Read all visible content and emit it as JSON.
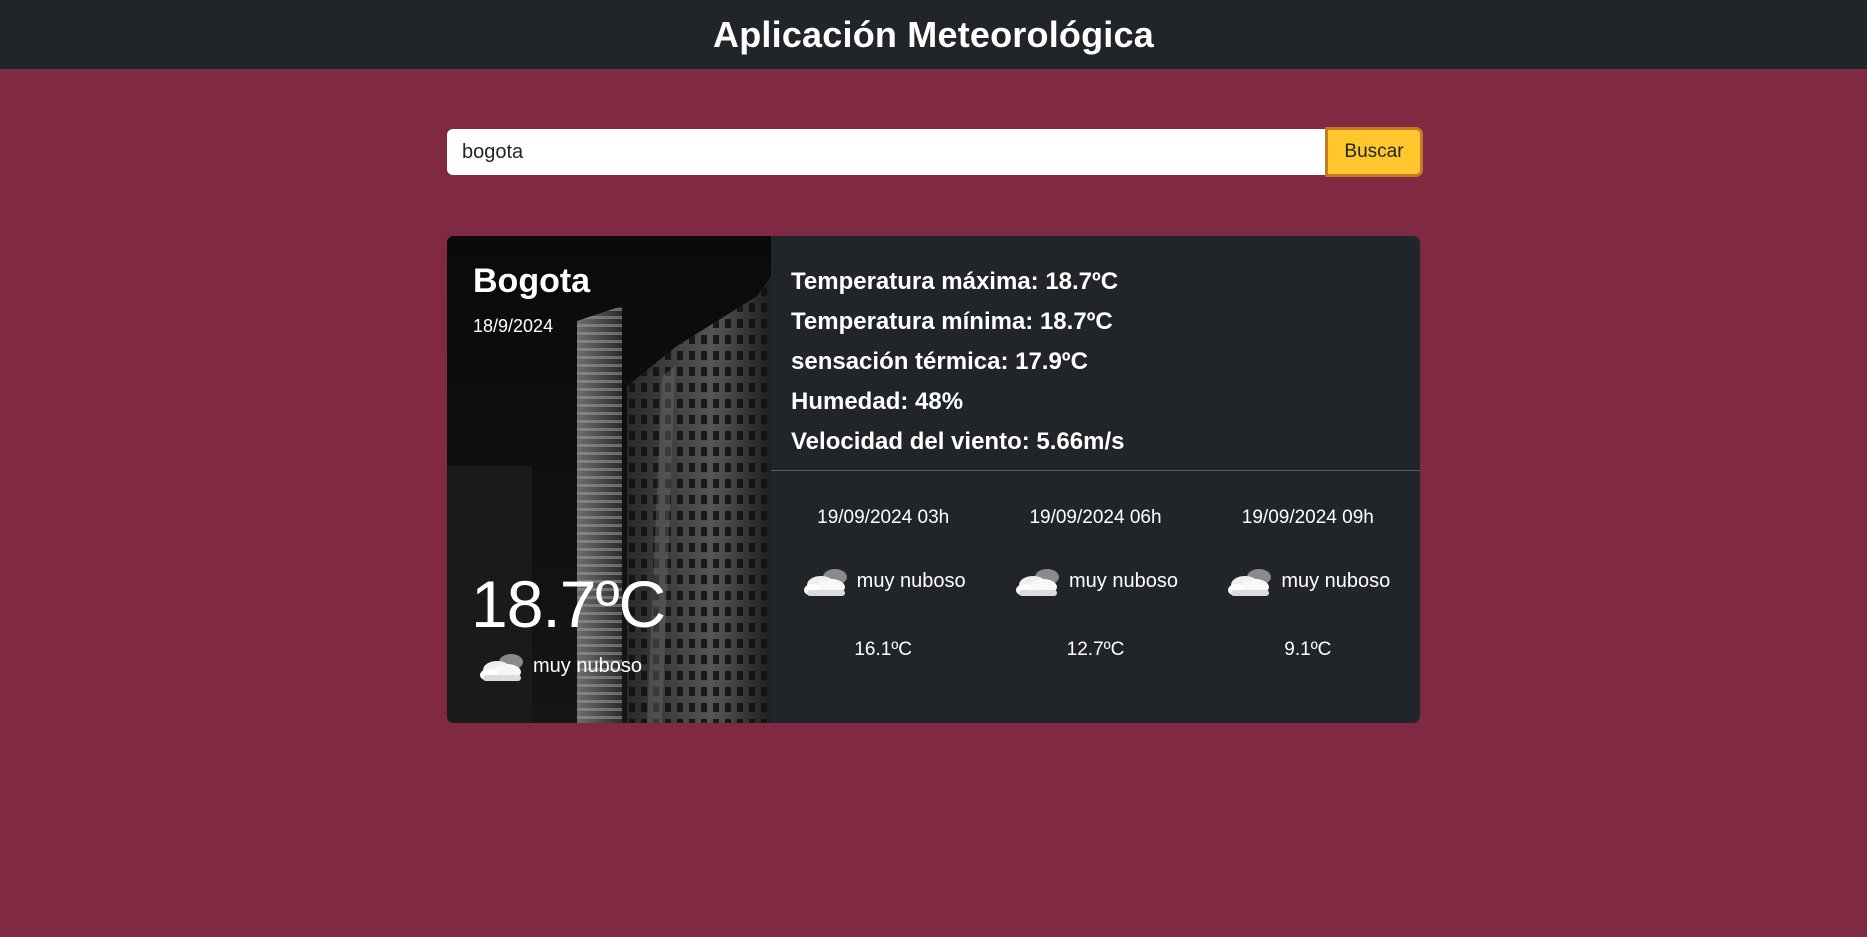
{
  "header": {
    "title": "Aplicación Meteorológica"
  },
  "search": {
    "value": "bogota",
    "button_label": "Buscar"
  },
  "current": {
    "city": "Bogota",
    "date": "18/9/2024",
    "temperature": "18.7ºC",
    "condition": "muy nuboso",
    "icon": "cloud-icon"
  },
  "details": {
    "max_temp": "Temperatura máxima: 18.7ºC",
    "min_temp": "Temperatura mínima: 18.7ºC",
    "feels_like": "sensación térmica: 17.9ºC",
    "humidity": "Humedad: 48%",
    "wind": "Velocidad del viento: 5.66m/s"
  },
  "forecast": [
    {
      "datetime": "19/09/2024 03h",
      "condition": "muy nuboso",
      "temperature": "16.1ºC",
      "icon": "cloud-icon"
    },
    {
      "datetime": "19/09/2024 06h",
      "condition": "muy nuboso",
      "temperature": "12.7ºC",
      "icon": "cloud-icon"
    },
    {
      "datetime": "19/09/2024 09h",
      "condition": "muy nuboso",
      "temperature": "9.1ºC",
      "icon": "cloud-icon"
    }
  ],
  "colors": {
    "page_background": "#802942",
    "navbar": "#212529",
    "card": "#212529",
    "button": "#ffc72c"
  }
}
